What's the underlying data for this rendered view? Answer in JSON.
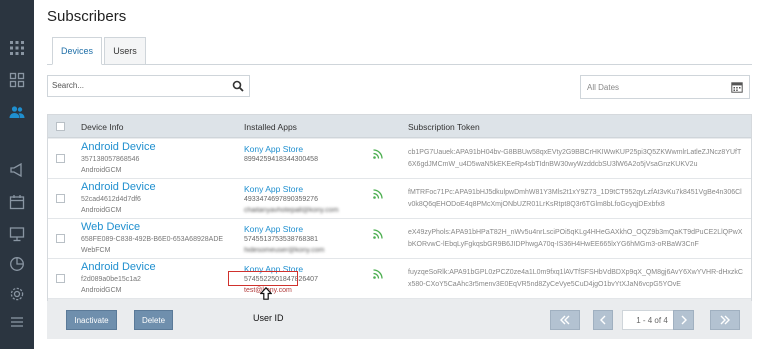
{
  "page": {
    "title": "Subscribers"
  },
  "tabs": [
    {
      "label": "Devices"
    },
    {
      "label": "Users"
    }
  ],
  "search": {
    "placeholder": "Search..."
  },
  "date_filter": {
    "value": "All Dates"
  },
  "table": {
    "columns": [
      "Device Info",
      "Installed Apps",
      "Subscription Token"
    ],
    "rows": [
      {
        "device_name": "Android Device",
        "device_id": "357138057868546",
        "device_type": "AndroidGCM",
        "app_name": "Kony App Store",
        "app_number": "899425941834430045​8",
        "app_user": "",
        "token": "cb1PG7Uauek:APA91bH04bv-G8BBUw58qxEVty2G9BBCrHKIWwKUP25pi3Q5ZKWwmlrLatleZJNcz8YUfT6X6gdJMCmW_u4D5waN5kEKEeRp4sbTIdnBW30wyWzddcbSU3lW6A2o5jVsaGnzKUKV2u"
      },
      {
        "device_name": "Android Device",
        "device_id": "52cad4612d4d7df6",
        "device_type": "AndroidGCM",
        "app_name": "Kony App Store",
        "app_number": "4933474697890359276",
        "app_user": "chaitanyavhotepall@kony.com",
        "token": "fMTRFoc71Pc:APA91bHJ5dkulpwDmhW81Y3Mls2t1xY9Z73_1D9tCT952qyLzfAt3vKu7k8451VgBe4n306Clv0k8Q6qEHODoE4q8PMcXmjONbUZR01LrKsRtpt8Q3r6TGlm8bLfoGcyqjDExbfx8"
      },
      {
        "device_name": "Web Device",
        "device_id": "658FE089-C838-492B-B6E0-653A68928ADE",
        "device_type": "WebFCM",
        "app_name": "Kony App Store",
        "app_number": "5745513753538768381",
        "app_user": "hidesomeuser@kony.com",
        "token": "eX49zyPhols:APA91bHPaT82H_nWv5u4nrLsciPOi5qKLg4HHeGAXkhO_OQZ9b3mQaKT9dPuCE2LlQPwXbKORvwC-lEbqLyFgkqsbGR9B6JIDPhwgA70q-IS36H4HwEE665lxYG6hMGm3-oRBaW3CnF"
      },
      {
        "device_name": "Android Device",
        "device_id": "f2d089a0be15c1a2",
        "device_type": "AndroidGCM",
        "app_name": "Kony App Store",
        "app_number": "5745522501847826407",
        "app_user": "test@kony.com",
        "token": "fuyzqeSoRlk:APA91bGPL0zPCZ0ze4a1L0m9fxq1lAVTfSFSHbVdBDXp9qX_QM8gj6AvY6XwYVHR-dHxzkCx580-CXoY5CaAhc3r5menv3E0EqVR5nd8ZyCeVye5CuD4jgO1bvYtXJaN6vcpG5YOvE"
      }
    ]
  },
  "annotation": {
    "label": "User ID"
  },
  "actions": {
    "inactivate": "Inactivate",
    "delete": "Delete"
  },
  "pagination": {
    "info": "1 - 4 of 4"
  },
  "colors": {
    "sidebar": "#2b3540",
    "accent": "#1f8fcf",
    "button": "#6f8fad",
    "highlight": "#d0312d"
  }
}
